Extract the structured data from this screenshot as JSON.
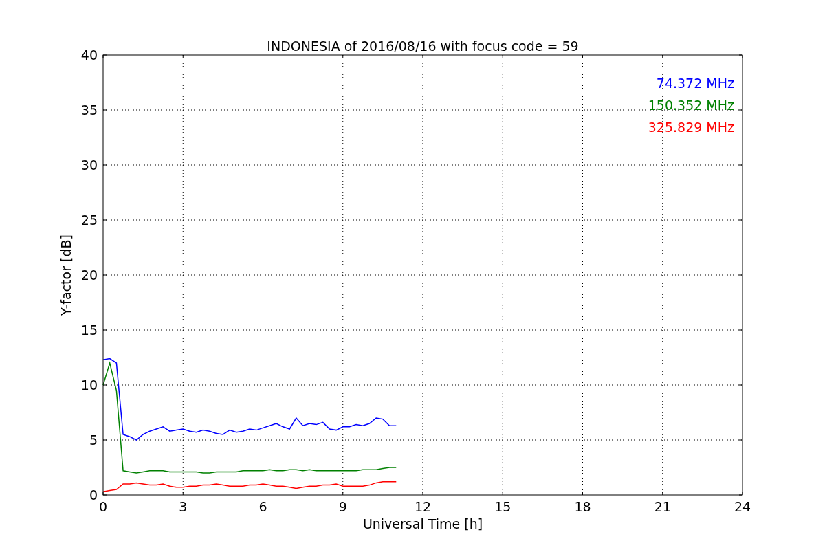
{
  "chart_data": {
    "type": "line",
    "title": "INDONESIA of 2016/08/16 with focus code = 59",
    "xlabel": "Universal Time [h]",
    "ylabel": "Y-factor [dB]",
    "x": [
      0,
      0.25,
      0.5,
      0.75,
      1,
      1.25,
      1.5,
      1.75,
      2,
      2.25,
      2.5,
      2.75,
      3,
      3.25,
      3.5,
      3.75,
      4,
      4.25,
      4.5,
      4.75,
      5,
      5.25,
      5.5,
      5.75,
      6,
      6.25,
      6.5,
      6.75,
      7,
      7.25,
      7.5,
      7.75,
      8,
      8.25,
      8.5,
      8.75,
      9,
      9.25,
      9.5,
      9.75,
      10,
      10.25,
      10.5,
      10.75,
      11
    ],
    "series": [
      {
        "name": "74.372 MHz",
        "color": "#0000ff",
        "values": [
          12.3,
          12.4,
          12.0,
          5.5,
          5.3,
          5.0,
          5.5,
          5.8,
          6.0,
          6.2,
          5.8,
          5.9,
          6.0,
          5.8,
          5.7,
          5.9,
          5.8,
          5.6,
          5.5,
          5.9,
          5.7,
          5.8,
          6.0,
          5.9,
          6.1,
          6.3,
          6.5,
          6.2,
          6.0,
          7.0,
          6.3,
          6.5,
          6.4,
          6.6,
          6.0,
          5.9,
          6.2,
          6.2,
          6.4,
          6.3,
          6.5,
          7.0,
          6.9,
          6.3,
          6.3
        ]
      },
      {
        "name": "150.352 MHz",
        "color": "#008000",
        "values": [
          10.0,
          12.0,
          9.5,
          2.2,
          2.1,
          2.0,
          2.1,
          2.2,
          2.2,
          2.2,
          2.1,
          2.1,
          2.1,
          2.1,
          2.1,
          2.0,
          2.0,
          2.1,
          2.1,
          2.1,
          2.1,
          2.2,
          2.2,
          2.2,
          2.2,
          2.3,
          2.2,
          2.2,
          2.3,
          2.3,
          2.2,
          2.3,
          2.2,
          2.2,
          2.2,
          2.2,
          2.2,
          2.2,
          2.2,
          2.3,
          2.3,
          2.3,
          2.4,
          2.5,
          2.5
        ]
      },
      {
        "name": "325.829 MHz",
        "color": "#ff0000",
        "values": [
          0.3,
          0.4,
          0.5,
          1.0,
          1.0,
          1.1,
          1.0,
          0.9,
          0.9,
          1.0,
          0.8,
          0.7,
          0.7,
          0.8,
          0.8,
          0.9,
          0.9,
          1.0,
          0.9,
          0.8,
          0.8,
          0.8,
          0.9,
          0.9,
          1.0,
          0.9,
          0.8,
          0.8,
          0.7,
          0.6,
          0.7,
          0.8,
          0.8,
          0.9,
          0.9,
          1.0,
          0.8,
          0.8,
          0.8,
          0.8,
          0.9,
          1.1,
          1.2,
          1.2,
          1.2
        ]
      }
    ],
    "xlim": [
      0,
      24
    ],
    "ylim": [
      0,
      40
    ],
    "xticks": [
      0,
      3,
      6,
      9,
      12,
      15,
      18,
      21,
      24
    ],
    "yticks": [
      0,
      5,
      10,
      15,
      20,
      25,
      30,
      35,
      40
    ],
    "grid": true
  }
}
